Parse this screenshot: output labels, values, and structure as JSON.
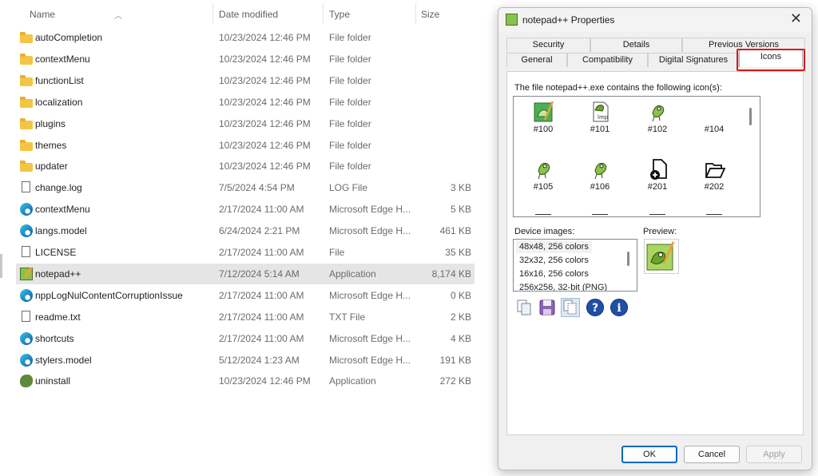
{
  "explorer": {
    "columns": {
      "name": "Name",
      "date": "Date modified",
      "type": "Type",
      "size": "Size"
    },
    "rows": [
      {
        "name": "autoCompletion",
        "date": "10/23/2024 12:46 PM",
        "type": "File folder",
        "size": "",
        "icon": "folder-icon"
      },
      {
        "name": "contextMenu",
        "date": "10/23/2024 12:46 PM",
        "type": "File folder",
        "size": "",
        "icon": "folder-icon"
      },
      {
        "name": "functionList",
        "date": "10/23/2024 12:46 PM",
        "type": "File folder",
        "size": "",
        "icon": "folder-icon"
      },
      {
        "name": "localization",
        "date": "10/23/2024 12:46 PM",
        "type": "File folder",
        "size": "",
        "icon": "folder-icon"
      },
      {
        "name": "plugins",
        "date": "10/23/2024 12:46 PM",
        "type": "File folder",
        "size": "",
        "icon": "folder-icon"
      },
      {
        "name": "themes",
        "date": "10/23/2024 12:46 PM",
        "type": "File folder",
        "size": "",
        "icon": "folder-icon"
      },
      {
        "name": "updater",
        "date": "10/23/2024 12:46 PM",
        "type": "File folder",
        "size": "",
        "icon": "folder-icon"
      },
      {
        "name": "change.log",
        "date": "7/5/2024 4:54 PM",
        "type": "LOG File",
        "size": "3 KB",
        "icon": "document-icon"
      },
      {
        "name": "contextMenu",
        "date": "2/17/2024 11:00 AM",
        "type": "Microsoft Edge H...",
        "size": "5 KB",
        "icon": "edge-icon"
      },
      {
        "name": "langs.model",
        "date": "6/24/2024 2:21 PM",
        "type": "Microsoft Edge H...",
        "size": "461 KB",
        "icon": "edge-icon"
      },
      {
        "name": "LICENSE",
        "date": "2/17/2024 11:00 AM",
        "type": "File",
        "size": "35 KB",
        "icon": "document-icon"
      },
      {
        "name": "notepad++",
        "date": "7/12/2024 5:14 AM",
        "type": "Application",
        "size": "8,174 KB",
        "icon": "notepadpp-icon",
        "selected": true
      },
      {
        "name": "nppLogNulContentCorruptionIssue",
        "date": "2/17/2024 11:00 AM",
        "type": "Microsoft Edge H...",
        "size": "0 KB",
        "icon": "edge-icon"
      },
      {
        "name": "readme.txt",
        "date": "2/17/2024 11:00 AM",
        "type": "TXT File",
        "size": "2 KB",
        "icon": "document-icon"
      },
      {
        "name": "shortcuts",
        "date": "2/17/2024 11:00 AM",
        "type": "Microsoft Edge H...",
        "size": "4 KB",
        "icon": "edge-icon"
      },
      {
        "name": "stylers.model",
        "date": "5/12/2024 1:23 AM",
        "type": "Microsoft Edge H...",
        "size": "191 KB",
        "icon": "edge-icon"
      },
      {
        "name": "uninstall",
        "date": "10/23/2024 12:46 PM",
        "type": "Application",
        "size": "272 KB",
        "icon": "uninstall-icon"
      }
    ]
  },
  "dialog": {
    "title": "notepad++ Properties",
    "close_glyph": "✕",
    "tabs_row1": [
      "Security",
      "Details",
      "Previous Versions"
    ],
    "tabs_row2": [
      "General",
      "Compatibility",
      "Digital Signatures",
      "Icons"
    ],
    "active_tab": "Icons",
    "highlight_color": "#d7191c",
    "icons_label": "The file notepad++.exe contains the following icon(s):",
    "icons": [
      {
        "label": "#100",
        "icon": "notepadpp-large-icon"
      },
      {
        "label": "#101",
        "icon": "notepadpp-doc-icon"
      },
      {
        "label": "#102",
        "icon": "chameleon-icon"
      },
      {
        "label": "#104",
        "icon": "blank-icon"
      },
      {
        "label": "#105",
        "icon": "chameleon-icon"
      },
      {
        "label": "#106",
        "icon": "chameleon-icon"
      },
      {
        "label": "#201",
        "icon": "new-file-icon"
      },
      {
        "label": "#202",
        "icon": "open-folder-icon"
      }
    ],
    "device_label": "Device images:",
    "device_images": [
      "48x48, 256 colors",
      "32x32, 256 colors",
      "16x16, 256 colors",
      "256x256, 32-bit (PNG)"
    ],
    "preview_label": "Preview:",
    "buttons": {
      "ok": "OK",
      "cancel": "Cancel",
      "apply": "Apply"
    }
  }
}
